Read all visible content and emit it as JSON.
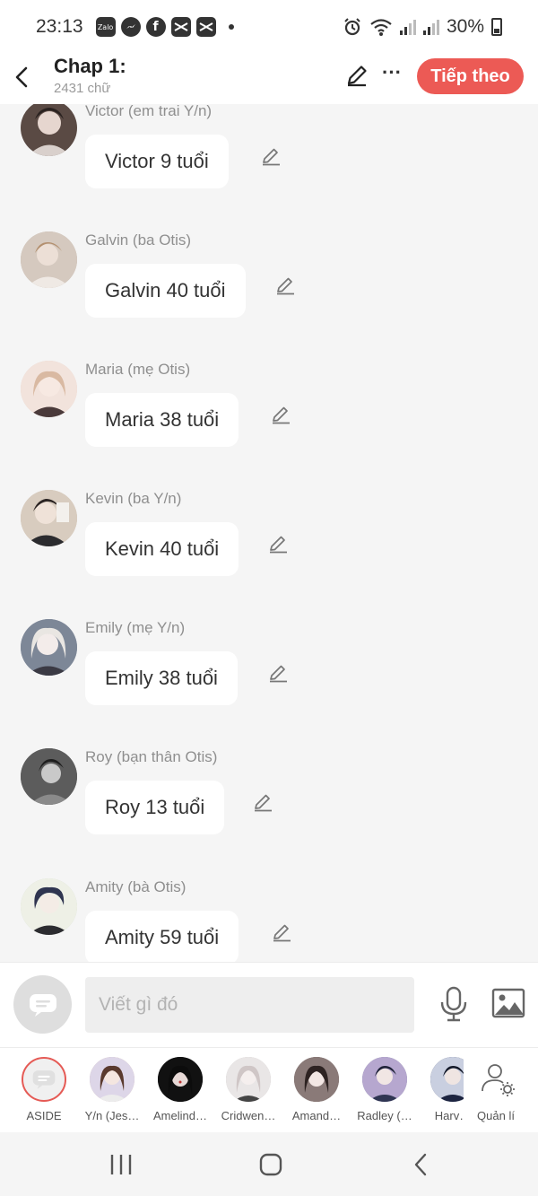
{
  "status_bar": {
    "time": "23:13",
    "battery": "30%",
    "app_icons": [
      "Zalo",
      "messenger-icon",
      "facebook-icon",
      "capcut-icon",
      "capcut-icon"
    ]
  },
  "header": {
    "title": "Chap 1:",
    "word_count": "2431 chữ",
    "next_label": "Tiếp theo"
  },
  "messages": [
    {
      "sender": "Victor (em trai Y/n)",
      "text": "Victor 9 tuổi",
      "avatar_color": "#5a4a44"
    },
    {
      "sender": "Galvin (ba Otis)",
      "text": "Galvin 40 tuổi",
      "avatar_color": "#b8a89a"
    },
    {
      "sender": "Maria (mẹ Otis)",
      "text": "Maria 38 tuổi",
      "avatar_color": "#e6c8bd"
    },
    {
      "sender": "Kevin (ba Y/n)",
      "text": "Kevin 40 tuổi",
      "avatar_color": "#c9b8a6"
    },
    {
      "sender": "Emily (mẹ Y/n)",
      "text": "Emily 38 tuổi",
      "avatar_color": "#8f97a8"
    },
    {
      "sender": "Roy (bạn thân Otis)",
      "text": "Roy 13 tuổi",
      "avatar_color": "#6a6a6a"
    },
    {
      "sender": "Amity (bà Otis)",
      "text": "Amity 59 tuổi",
      "avatar_color": "#c3d1bf"
    }
  ],
  "input": {
    "placeholder": "Viết gì đó"
  },
  "characters": [
    {
      "label": "ASIDE",
      "color": "#f0f0f0"
    },
    {
      "label": "Y/n (Jes…",
      "color": "#c8a594"
    },
    {
      "label": "Amelind…",
      "color": "#1e1e22"
    },
    {
      "label": "Cridwen…",
      "color": "#b9b4b4"
    },
    {
      "label": "Amand…",
      "color": "#5b4a48"
    },
    {
      "label": "Radley (…",
      "color": "#6a7190"
    },
    {
      "label": "Harv…",
      "color": "#2e3a5a"
    },
    {
      "label": "Quản lí",
      "color": "#ffffff"
    }
  ],
  "colors": {
    "accent": "#ec5a55",
    "background": "#f5f5f5",
    "bubble": "#ffffff"
  }
}
